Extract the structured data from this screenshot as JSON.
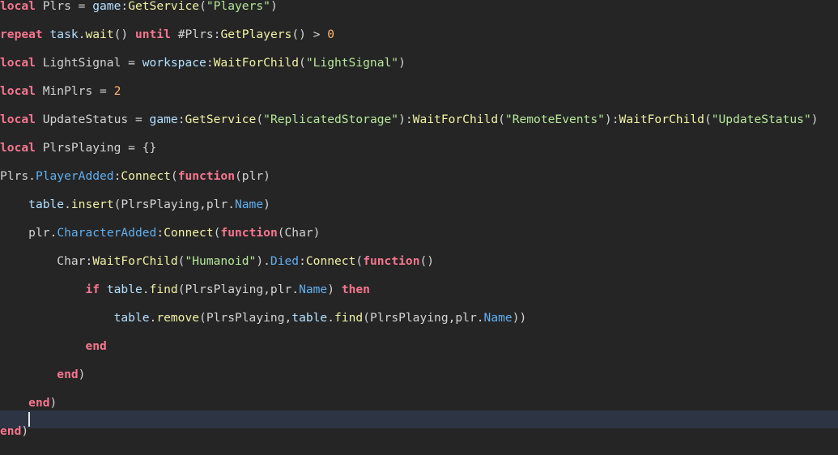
{
  "editor": {
    "colors": {
      "background": "#252526",
      "current_line": "#2d3544",
      "keyword": "#f7768e",
      "global": "#b4e0ff",
      "function": "#f2f2a3",
      "string": "#b6e899",
      "number": "#ffb86c",
      "property": "#61afef",
      "text": "#d4d4d4"
    },
    "lines": [
      {
        "tokens": [
          [
            "kw",
            "local"
          ],
          [
            "id",
            " Plrs = "
          ],
          [
            "gl",
            "game"
          ],
          [
            "op",
            ":"
          ],
          [
            "fn",
            "GetService"
          ],
          [
            "op",
            "("
          ],
          [
            "str",
            "\"Players\""
          ],
          [
            "op",
            ")"
          ]
        ]
      },
      {
        "tokens": [
          [
            "kw",
            "repeat"
          ],
          [
            "id",
            " "
          ],
          [
            "gl",
            "task"
          ],
          [
            "op",
            "."
          ],
          [
            "fn",
            "wait"
          ],
          [
            "op",
            "() "
          ],
          [
            "kw",
            "until"
          ],
          [
            "id",
            " #Plrs:"
          ],
          [
            "fn",
            "GetPlayers"
          ],
          [
            "op",
            "() > "
          ],
          [
            "num",
            "0"
          ]
        ]
      },
      {
        "tokens": [
          [
            "kw",
            "local"
          ],
          [
            "id",
            " LightSignal = "
          ],
          [
            "gl",
            "workspace"
          ],
          [
            "op",
            ":"
          ],
          [
            "fn",
            "WaitForChild"
          ],
          [
            "op",
            "("
          ],
          [
            "str",
            "\"LightSignal\""
          ],
          [
            "op",
            ")"
          ]
        ]
      },
      {
        "tokens": [
          [
            "kw",
            "local"
          ],
          [
            "id",
            " MinPlrs = "
          ],
          [
            "num",
            "2"
          ]
        ]
      },
      {
        "tokens": [
          [
            "kw",
            "local"
          ],
          [
            "id",
            " UpdateStatus = "
          ],
          [
            "gl",
            "game"
          ],
          [
            "op",
            ":"
          ],
          [
            "fn",
            "GetService"
          ],
          [
            "op",
            "("
          ],
          [
            "str",
            "\"ReplicatedStorage\""
          ],
          [
            "op",
            "):"
          ],
          [
            "fn",
            "WaitForChild"
          ],
          [
            "op",
            "("
          ],
          [
            "str",
            "\"RemoteEvents\""
          ],
          [
            "op",
            "):"
          ],
          [
            "fn",
            "WaitForChild"
          ],
          [
            "op",
            "("
          ],
          [
            "str",
            "\"UpdateStatus\""
          ],
          [
            "op",
            ")"
          ]
        ]
      },
      {
        "tokens": [
          [
            "kw",
            "local"
          ],
          [
            "id",
            " PlrsPlaying = {}"
          ]
        ]
      },
      {
        "tokens": [
          [
            "id",
            "Plrs."
          ],
          [
            "prop",
            "PlayerAdded"
          ],
          [
            "op",
            ":"
          ],
          [
            "fn",
            "Connect"
          ],
          [
            "op",
            "("
          ],
          [
            "kw",
            "function"
          ],
          [
            "op",
            "(plr)"
          ]
        ]
      },
      {
        "tokens": [
          [
            "ind",
            "    "
          ],
          [
            "gl",
            "table"
          ],
          [
            "op",
            "."
          ],
          [
            "fn",
            "insert"
          ],
          [
            "op",
            "(PlrsPlaying,plr."
          ],
          [
            "prop",
            "Name"
          ],
          [
            "op",
            ")"
          ]
        ]
      },
      {
        "tokens": [
          [
            "ind",
            "    "
          ],
          [
            "id",
            "plr."
          ],
          [
            "prop",
            "CharacterAdded"
          ],
          [
            "op",
            ":"
          ],
          [
            "fn",
            "Connect"
          ],
          [
            "op",
            "("
          ],
          [
            "kw",
            "function"
          ],
          [
            "op",
            "(Char)"
          ]
        ]
      },
      {
        "tokens": [
          [
            "ind",
            "        "
          ],
          [
            "id",
            "Char:"
          ],
          [
            "fn",
            "WaitForChild"
          ],
          [
            "op",
            "("
          ],
          [
            "str",
            "\"Humanoid\""
          ],
          [
            "op",
            ")."
          ],
          [
            "prop",
            "Died"
          ],
          [
            "op",
            ":"
          ],
          [
            "fn",
            "Connect"
          ],
          [
            "op",
            "("
          ],
          [
            "kw",
            "function"
          ],
          [
            "op",
            "()"
          ]
        ]
      },
      {
        "tokens": [
          [
            "ind",
            "            "
          ],
          [
            "kw",
            "if"
          ],
          [
            "id",
            " "
          ],
          [
            "gl",
            "table"
          ],
          [
            "op",
            "."
          ],
          [
            "fn",
            "find"
          ],
          [
            "op",
            "(PlrsPlaying,plr."
          ],
          [
            "prop",
            "Name"
          ],
          [
            "op",
            ") "
          ],
          [
            "kw",
            "then"
          ]
        ]
      },
      {
        "tokens": [
          [
            "ind",
            "                "
          ],
          [
            "gl",
            "table"
          ],
          [
            "op",
            "."
          ],
          [
            "fn",
            "remove"
          ],
          [
            "op",
            "(PlrsPlaying,"
          ],
          [
            "gl",
            "table"
          ],
          [
            "op",
            "."
          ],
          [
            "fn",
            "find"
          ],
          [
            "op",
            "(PlrsPlaying,plr."
          ],
          [
            "prop",
            "Name"
          ],
          [
            "op",
            "))"
          ]
        ]
      },
      {
        "tokens": [
          [
            "ind",
            "            "
          ],
          [
            "kw",
            "end"
          ]
        ]
      },
      {
        "tokens": [
          [
            "ind",
            "        "
          ],
          [
            "kw",
            "end"
          ],
          [
            "op",
            ")"
          ]
        ]
      },
      {
        "tokens": [
          [
            "ind",
            "    "
          ],
          [
            "kw",
            "end"
          ],
          [
            "op",
            ")"
          ]
        ]
      },
      {
        "tokens": [
          [
            "ind",
            "    "
          ]
        ],
        "current": true
      },
      {
        "tokens": [
          [
            "kw",
            "end"
          ],
          [
            "op",
            ")"
          ]
        ]
      }
    ]
  }
}
